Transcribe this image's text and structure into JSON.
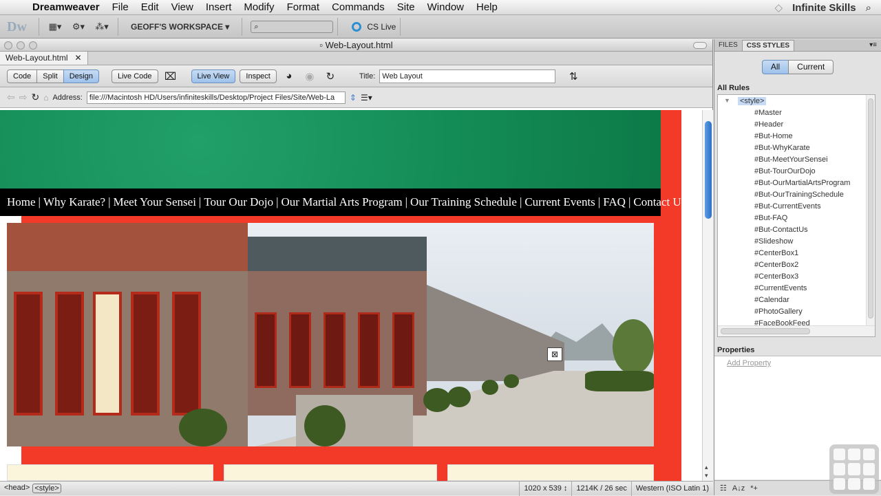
{
  "menubar": {
    "app": "Dreamweaver",
    "items": [
      "File",
      "Edit",
      "View",
      "Insert",
      "Modify",
      "Format",
      "Commands",
      "Site",
      "Window",
      "Help"
    ],
    "brand": "Infinite Skills"
  },
  "apptoolbar": {
    "logo": "Dw",
    "workspace": "GEOFF'S WORKSPACE ▾",
    "search_placeholder": "",
    "cslive": "CS Live"
  },
  "document": {
    "window_title": "Web-Layout.html",
    "tab": "Web-Layout.html",
    "views": {
      "code": "Code",
      "split": "Split",
      "design": "Design"
    },
    "live_code": "Live Code",
    "live_view": "Live View",
    "inspect": "Inspect",
    "title_label": "Title:",
    "title_value": "Web Layout",
    "address_label": "Address:",
    "address_value": "file:///Macintosh HD/Users/infiniteskills/Desktop/Project Files/Site/Web-La"
  },
  "webpage": {
    "nav": [
      "Home",
      "Why Karate?",
      "Meet Your Sensei",
      "Tour Our Dojo",
      "Our Martial Arts Program",
      "Our Training Schedule",
      "Current Events",
      "FAQ",
      "Contact Us"
    ],
    "colors": {
      "header": "#15905a",
      "background": "#f33a28",
      "nav": "#000000"
    }
  },
  "statusbar": {
    "tags": [
      "<head>",
      "<style>"
    ],
    "size": "1020 x 539 ↕",
    "weight": "1214K / 26 sec",
    "encoding": "Western (ISO Latin 1)"
  },
  "panel": {
    "tabs": {
      "files": "FILES",
      "css": "CSS STYLES"
    },
    "all": "All",
    "current": "Current",
    "all_rules": "All Rules",
    "root_rule": "<style>",
    "rules": [
      "#Master",
      "#Header",
      "#But-Home",
      "#But-WhyKarate",
      "#But-MeetYourSensei",
      "#But-TourOurDojo",
      "#But-OurMartialArtsProgram",
      "#But-OurTrainingSchedule",
      "#But-CurrentEvents",
      "#But-FAQ",
      "#But-ContactUs",
      "#Slideshow",
      "#CenterBox1",
      "#CenterBox2",
      "#CenterBox3",
      "#CurrentEvents",
      "#Calendar",
      "#PhotoGallery",
      "#FaceBookFeed"
    ],
    "properties": "Properties",
    "add_property": "Add Property"
  }
}
